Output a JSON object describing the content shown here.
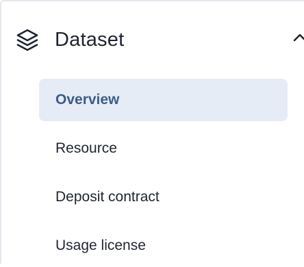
{
  "section": {
    "title": "Dataset",
    "icon": "layers-icon",
    "toggle_icon": "chevron-up-icon",
    "expanded": true
  },
  "nav": {
    "items": [
      {
        "label": "Overview",
        "active": true
      },
      {
        "label": "Resource",
        "active": false
      },
      {
        "label": "Deposit contract",
        "active": false
      },
      {
        "label": "Usage license",
        "active": false
      }
    ]
  },
  "colors": {
    "active_bg": "#e6ecf5",
    "active_text": "#3c5c89",
    "text": "#1f2530",
    "border": "#e4e8ee"
  }
}
